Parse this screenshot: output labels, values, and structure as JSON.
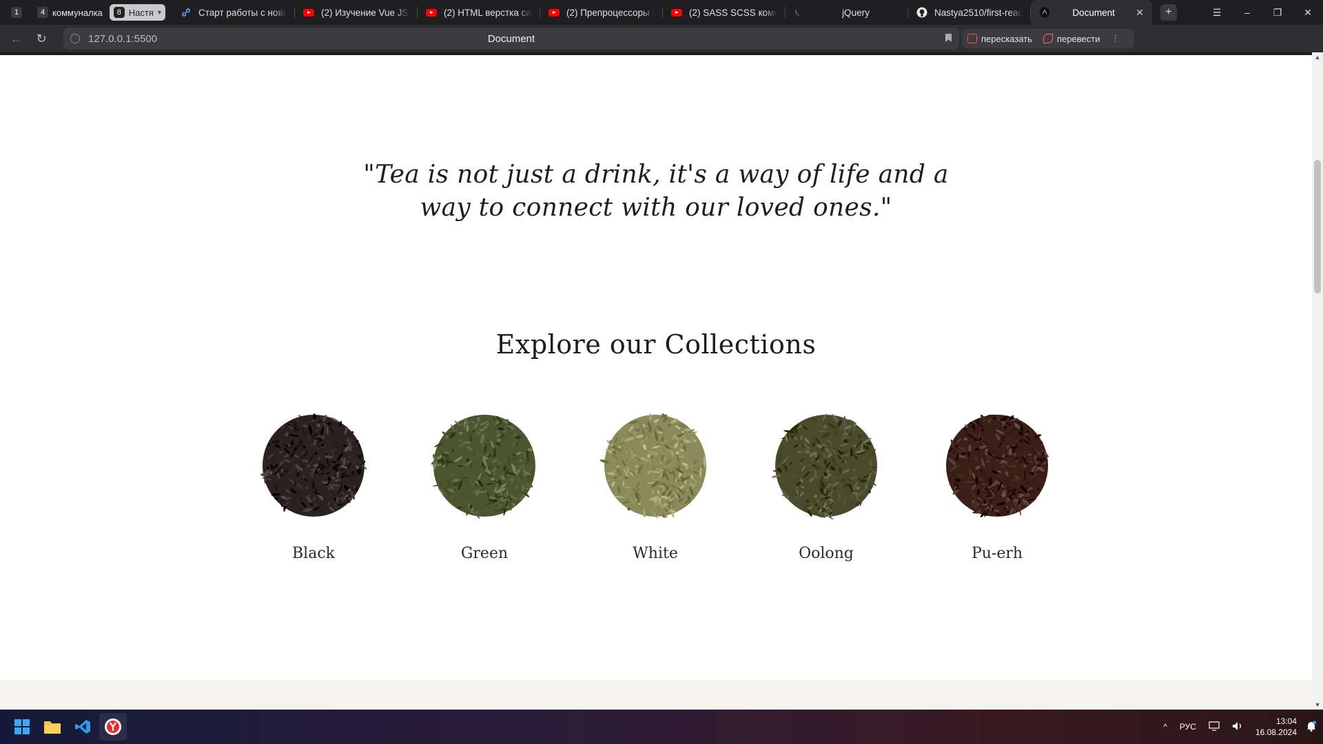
{
  "browser": {
    "tab_groups": [
      {
        "count": "1",
        "label": ""
      },
      {
        "count": "4",
        "label": "коммуналка"
      },
      {
        "count": "8",
        "label": "Настя"
      }
    ],
    "tabs": [
      {
        "title": "Старт работы с новы",
        "icon": "link-icon"
      },
      {
        "title": "(2) Изучение Vue JS с",
        "icon": "youtube-icon"
      },
      {
        "title": "(2) HTML верстка сай",
        "icon": "youtube-icon"
      },
      {
        "title": "(2) Препроцессоры S",
        "icon": "youtube-icon"
      },
      {
        "title": "(2) SASS SCSS компи",
        "icon": "youtube-icon"
      },
      {
        "title": "jQuery",
        "icon": "jquery-icon"
      },
      {
        "title": "Nastya2510/first-reac",
        "icon": "github-icon"
      },
      {
        "title": "Document",
        "icon": "page-icon",
        "active": true
      }
    ],
    "address": {
      "url": "127.0.0.1:5500",
      "page_title": "Document"
    },
    "actions": {
      "retell_label": "пересказать",
      "translate_label": "перевести"
    }
  },
  "page": {
    "quote_line1": "\"Tea is not just a drink, it's a way of life and a",
    "quote_line2": "way to connect with our loved ones.\"",
    "collections_title": "Explore our Collections",
    "teas": [
      {
        "name": "Black",
        "color": "#2b2220"
      },
      {
        "name": "Green",
        "color": "#4b5530"
      },
      {
        "name": "White",
        "color": "#8b8a5a"
      },
      {
        "name": "Oolong",
        "color": "#4a4a2c"
      },
      {
        "name": "Pu-erh",
        "color": "#3a1f18"
      }
    ]
  },
  "taskbar": {
    "language": "РУС",
    "time": "13:04",
    "date": "16.08.2024"
  }
}
